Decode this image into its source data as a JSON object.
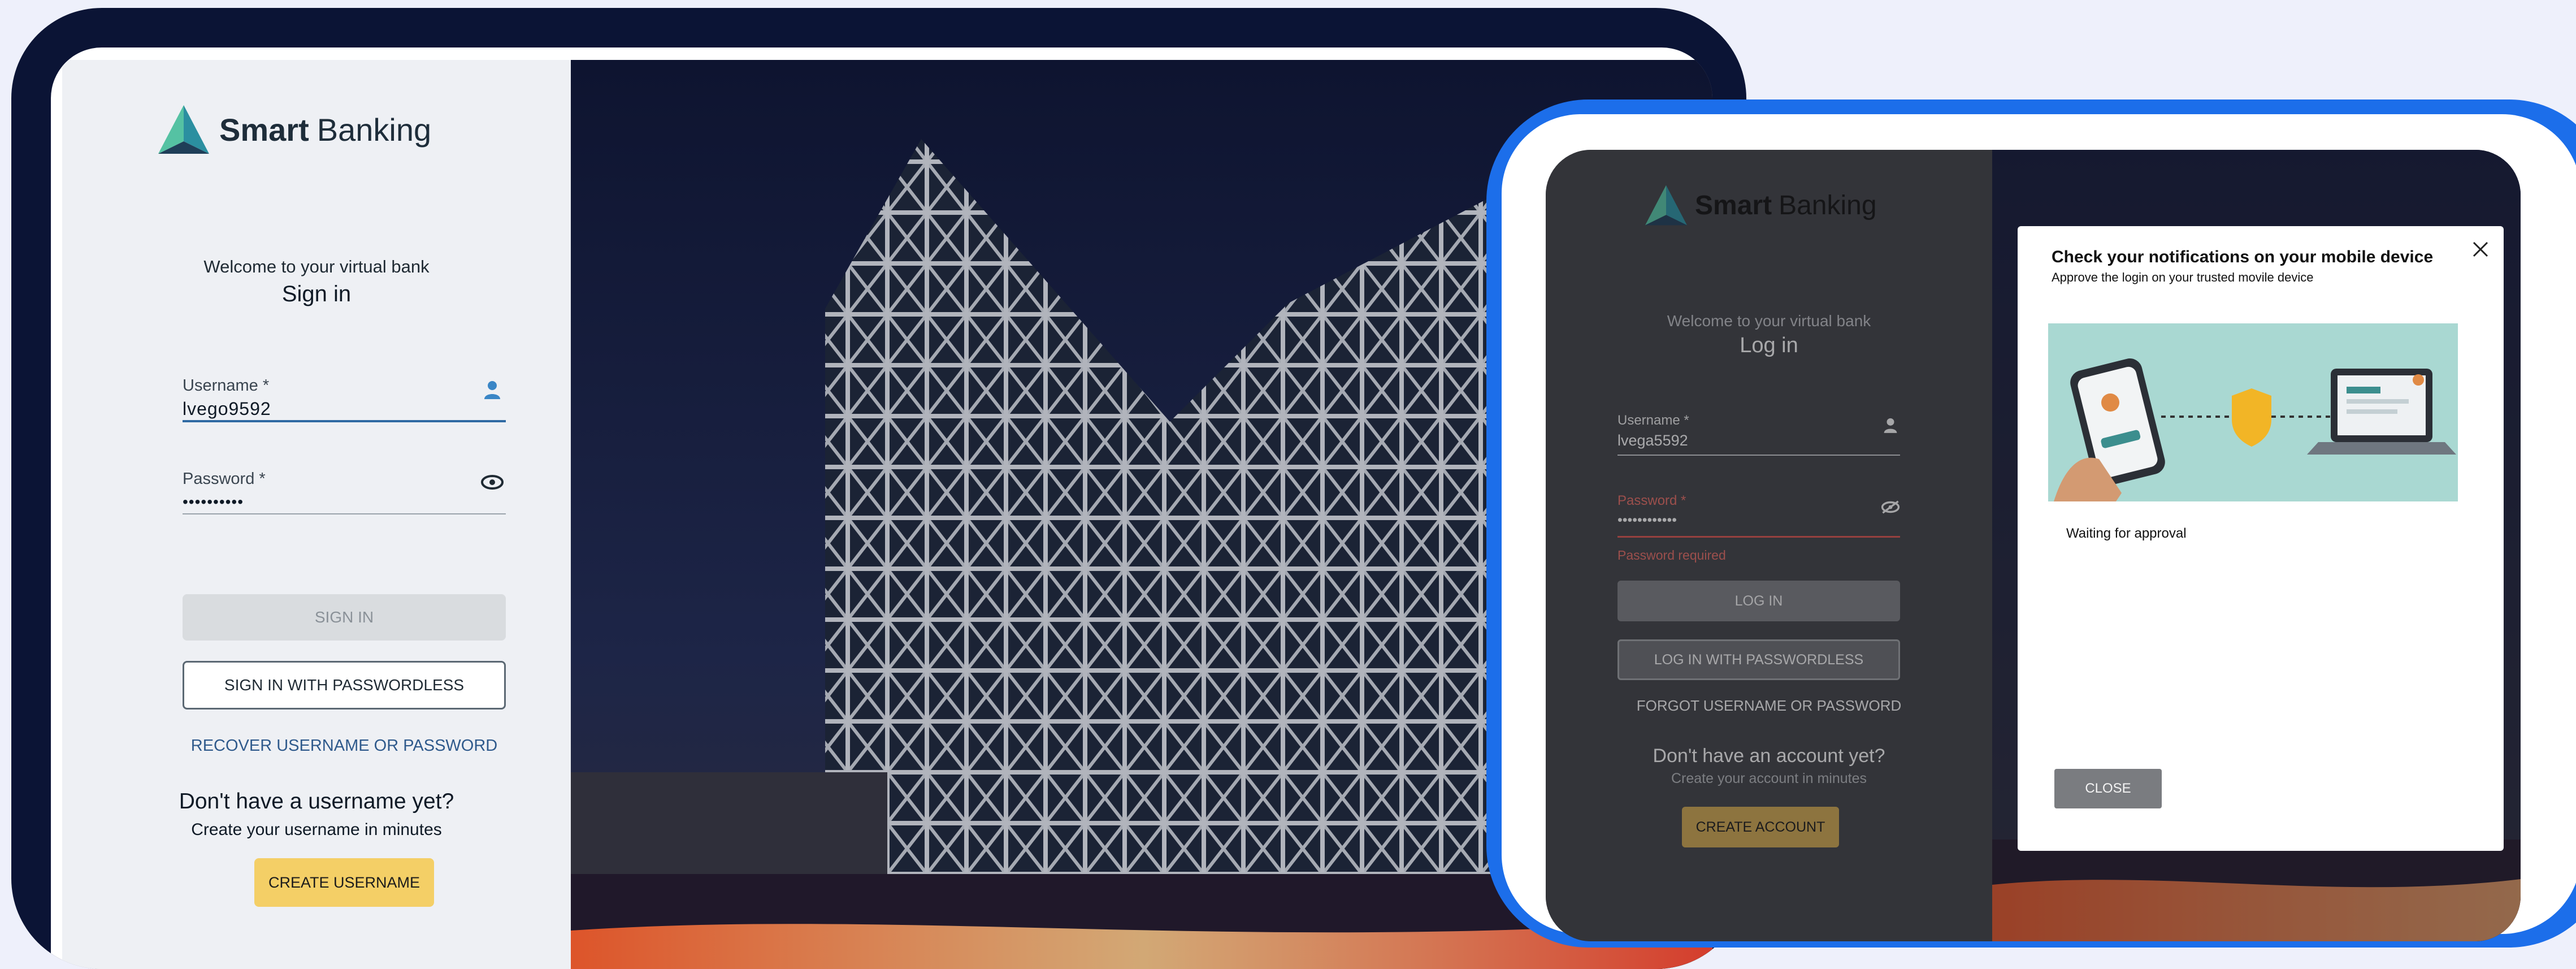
{
  "left_screen": {
    "logo": {
      "strong": "Smart",
      "light": "Banking"
    },
    "welcome": "Welcome to your virtual bank",
    "heading": "Sign in",
    "username": {
      "label": "Username *",
      "value": "lvego9592"
    },
    "password": {
      "label": "Password *",
      "value": "••••••••••"
    },
    "sign_in_button": "SIGN IN",
    "passwordless_button": "SIGN IN WITH PASSWORDLESS",
    "recover_link": "RECOVER USERNAME OR PASSWORD",
    "no_account_title": "Don't have a username yet?",
    "no_account_sub": "Create your username in minutes",
    "create_button": "CREATE USERNAME"
  },
  "right_screen": {
    "logo": {
      "strong": "Smart",
      "light": "Banking"
    },
    "welcome": "Welcome to your virtual bank",
    "heading": "Log in",
    "username": {
      "label": "Username *",
      "value": "lvega5592"
    },
    "password": {
      "label": "Password *",
      "value": "••••••••••••",
      "error": "Password required"
    },
    "login_button": "LOG IN",
    "passwordless_button": "LOG IN WITH PASSWORDLESS",
    "forgot_link": "FORGOT USERNAME OR PASSWORD",
    "no_account_title": "Don't have an account yet?",
    "no_account_sub": "Create your account in minutes",
    "create_button": "CREATE ACCOUNT",
    "modal": {
      "title": "Check your notifications on your mobile device",
      "subtitle": "Approve the login on your trusted movile device",
      "status": "Waiting for approval",
      "close_button": "CLOSE"
    }
  },
  "icons": {
    "user": "user-icon",
    "eye": "eye-icon",
    "eye_off": "eye-off-icon",
    "close": "close-icon"
  },
  "colors": {
    "accent_blue": "#1c6eea",
    "dark_navy": "#0b1435",
    "create_yellow": "#f4cf66",
    "create_gold": "#c9a44f",
    "error_red": "#d9534f",
    "link_blue": "#2f5a8c"
  }
}
